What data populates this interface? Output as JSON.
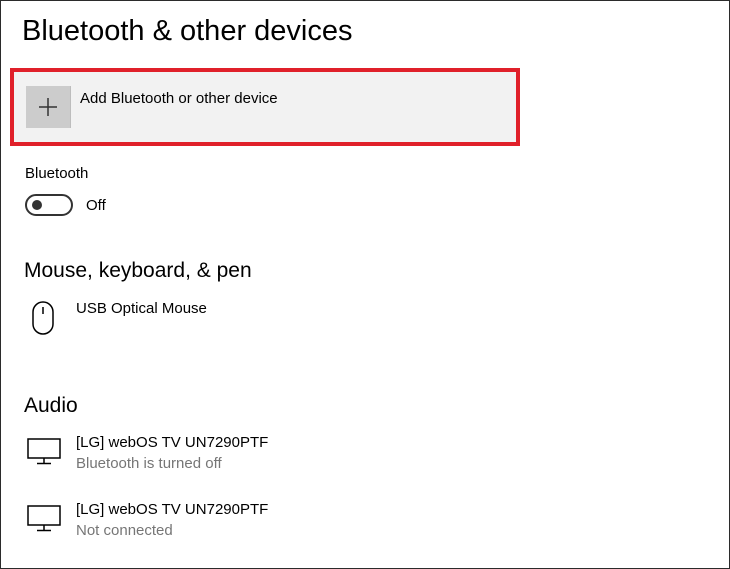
{
  "page": {
    "title": "Bluetooth & other devices"
  },
  "add_device": {
    "label": "Add Bluetooth or other device",
    "icon": "plus-icon",
    "highlight_color": "#e0202a"
  },
  "bluetooth": {
    "label": "Bluetooth",
    "toggle_state": "Off",
    "enabled": false
  },
  "sections": {
    "mouse": {
      "heading": "Mouse, keyboard, & pen",
      "devices": [
        {
          "name": "USB Optical Mouse",
          "status": "",
          "icon": "mouse-icon"
        }
      ]
    },
    "audio": {
      "heading": "Audio",
      "devices": [
        {
          "name": "[LG] webOS TV UN7290PTF",
          "status": "Bluetooth is turned off",
          "icon": "monitor-icon"
        },
        {
          "name": "[LG] webOS TV UN7290PTF",
          "status": "Not connected",
          "icon": "monitor-icon"
        }
      ]
    }
  },
  "colors": {
    "secondary_text": "#767676",
    "tile_bg": "#cccccc",
    "button_bg": "#f2f2f2"
  }
}
